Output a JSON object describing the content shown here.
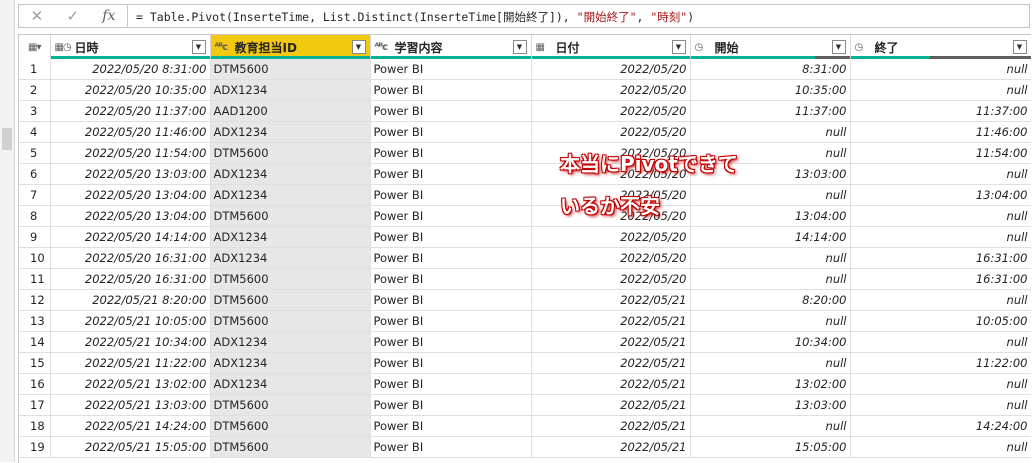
{
  "formula": {
    "cancel_icon": "✕",
    "confirm_icon": "✓",
    "fx_label": "fx",
    "text_prefix": "= Table.Pivot(InserteTime, List.Distinct(InserteTime[開始終了]), ",
    "text_str1": "\"開始終了\"",
    "text_sep": ", ",
    "text_str2": "\"時刻\"",
    "text_suffix": ")"
  },
  "columns": [
    {
      "label": "日時",
      "type_icon": "datetime-icon"
    },
    {
      "label": "教育担当ID",
      "type_icon": "text-icon",
      "selected": true
    },
    {
      "label": "学習内容",
      "type_icon": "text-icon"
    },
    {
      "label": "日付",
      "type_icon": "date-icon"
    },
    {
      "label": "開始",
      "type_icon": "time-icon",
      "quality": 0.78
    },
    {
      "label": "終了",
      "type_icon": "time-icon",
      "quality": 0.44
    }
  ],
  "rows": [
    [
      "1",
      "2022/05/20 8:31:00",
      "DTM5600",
      "Power BI",
      "2022/05/20",
      "8:31:00",
      "null"
    ],
    [
      "2",
      "2022/05/20 10:35:00",
      "ADX1234",
      "Power BI",
      "2022/05/20",
      "10:35:00",
      "null"
    ],
    [
      "3",
      "2022/05/20 11:37:00",
      "AAD1200",
      "Power BI",
      "2022/05/20",
      "11:37:00",
      "11:37:00"
    ],
    [
      "4",
      "2022/05/20 11:46:00",
      "ADX1234",
      "Power BI",
      "2022/05/20",
      "null",
      "11:46:00"
    ],
    [
      "5",
      "2022/05/20 11:54:00",
      "DTM5600",
      "Power BI",
      "2022/05/20",
      "null",
      "11:54:00"
    ],
    [
      "6",
      "2022/05/20 13:03:00",
      "ADX1234",
      "Power BI",
      "2022/05/20",
      "13:03:00",
      "null"
    ],
    [
      "7",
      "2022/05/20 13:04:00",
      "ADX1234",
      "Power BI",
      "2022/05/20",
      "null",
      "13:04:00"
    ],
    [
      "8",
      "2022/05/20 13:04:00",
      "DTM5600",
      "Power BI",
      "2022/05/20",
      "13:04:00",
      "null"
    ],
    [
      "9",
      "2022/05/20 14:14:00",
      "ADX1234",
      "Power BI",
      "2022/05/20",
      "14:14:00",
      "null"
    ],
    [
      "10",
      "2022/05/20 16:31:00",
      "ADX1234",
      "Power BI",
      "2022/05/20",
      "null",
      "16:31:00"
    ],
    [
      "11",
      "2022/05/20 16:31:00",
      "DTM5600",
      "Power BI",
      "2022/05/20",
      "null",
      "16:31:00"
    ],
    [
      "12",
      "2022/05/21 8:20:00",
      "DTM5600",
      "Power BI",
      "2022/05/21",
      "8:20:00",
      "null"
    ],
    [
      "13",
      "2022/05/21 10:05:00",
      "DTM5600",
      "Power BI",
      "2022/05/21",
      "null",
      "10:05:00"
    ],
    [
      "14",
      "2022/05/21 10:34:00",
      "ADX1234",
      "Power BI",
      "2022/05/21",
      "10:34:00",
      "null"
    ],
    [
      "15",
      "2022/05/21 11:22:00",
      "ADX1234",
      "Power BI",
      "2022/05/21",
      "null",
      "11:22:00"
    ],
    [
      "16",
      "2022/05/21 13:02:00",
      "ADX1234",
      "Power BI",
      "2022/05/21",
      "13:02:00",
      "null"
    ],
    [
      "17",
      "2022/05/21 13:03:00",
      "DTM5600",
      "Power BI",
      "2022/05/21",
      "13:03:00",
      "null"
    ],
    [
      "18",
      "2022/05/21 14:24:00",
      "DTM5600",
      "Power BI",
      "2022/05/21",
      "null",
      "14:24:00"
    ],
    [
      "19",
      "2022/05/21 15:05:00",
      "DTM5600",
      "Power BI",
      "2022/05/21",
      "15:05:00",
      "null"
    ]
  ],
  "annotation": {
    "line1": "本当にPivotできて",
    "line2": "いるか不安"
  },
  "colors": {
    "selected_header": "#f2c811",
    "quality_bar": "#00b294",
    "annotation_outline": "#c00000"
  }
}
